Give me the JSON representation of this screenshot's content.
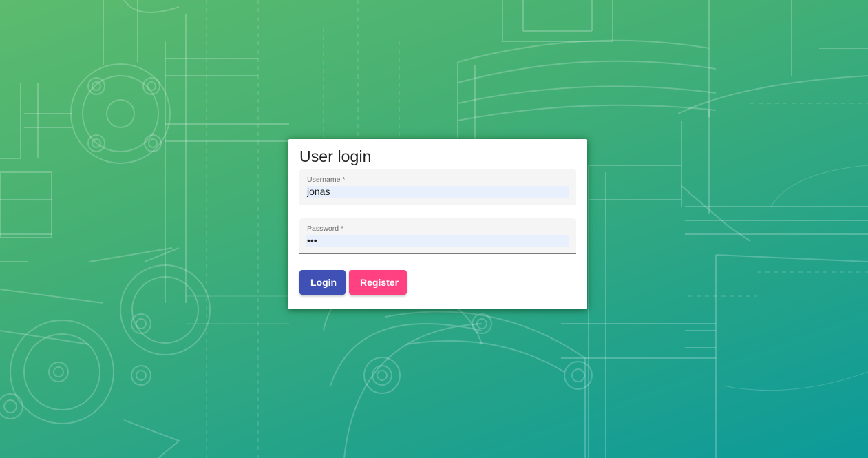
{
  "login": {
    "title": "User login",
    "username_label": "Username *",
    "username_value": "jonas",
    "password_label": "Password *",
    "password_value": "abc",
    "login_label": "Login",
    "register_label": "Register"
  },
  "colors": {
    "primary": "#3f51b5",
    "accent": "#ff4081",
    "background_start": "#5cbb6e",
    "background_end": "#0c9a9a"
  },
  "background": {
    "image": "industrial-valve-line-drawing"
  }
}
